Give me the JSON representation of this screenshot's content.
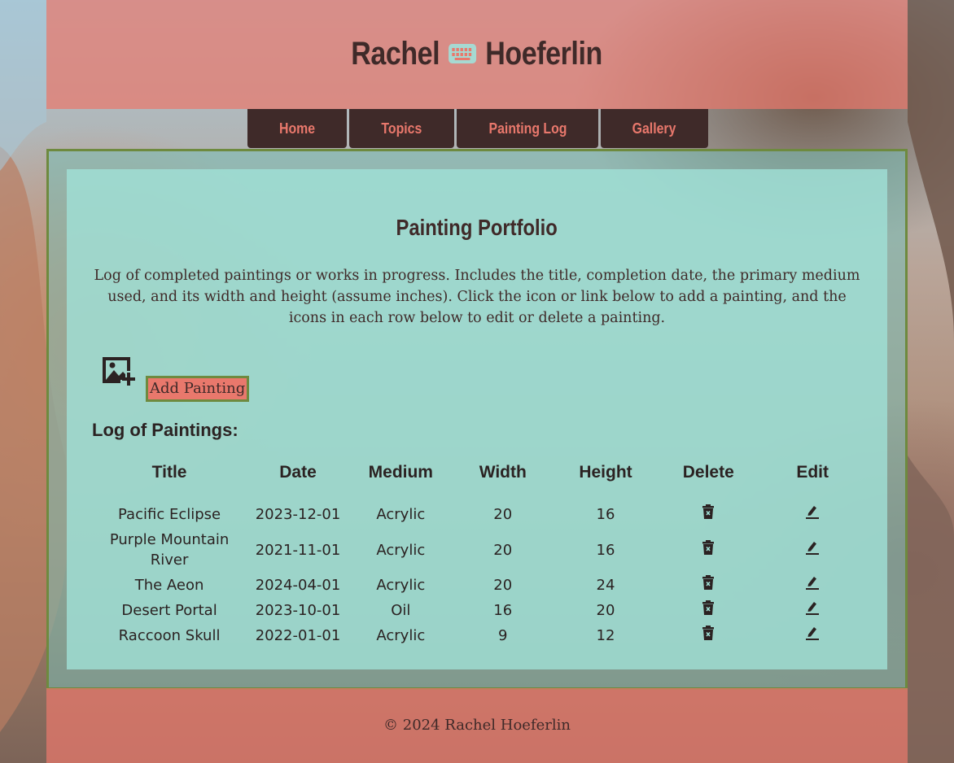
{
  "header": {
    "first_name": "Rachel",
    "last_name": "Hoeferlin",
    "logo_icon": "keyboard-icon"
  },
  "nav": {
    "home": "Home",
    "topics": "Topics",
    "painting_log": "Painting Log",
    "gallery": "Gallery"
  },
  "main": {
    "title": "Painting Portfolio",
    "intro": "Log of completed paintings or works in progress. Includes the title, completion date, the primary medium used, and its width and height (assume inches). Click the icon or link below to add a painting, and the icons in each row below to edit or delete a painting.",
    "add_icon": "add-image-icon",
    "add_link": "Add Painting",
    "log_heading": "Log of Paintings:"
  },
  "table": {
    "headers": {
      "title": "Title",
      "date": "Date",
      "medium": "Medium",
      "width": "Width",
      "height": "Height",
      "delete": "Delete",
      "edit": "Edit"
    },
    "rows": [
      {
        "title": "Pacific Eclipse",
        "date": "2023-12-01",
        "medium": "Acrylic",
        "width": "20",
        "height": "16"
      },
      {
        "title": "Purple Mountain River",
        "date": "2021-11-01",
        "medium": "Acrylic",
        "width": "20",
        "height": "16"
      },
      {
        "title": "The Aeon",
        "date": "2024-04-01",
        "medium": "Acrylic",
        "width": "20",
        "height": "24"
      },
      {
        "title": "Desert Portal",
        "date": "2023-10-01",
        "medium": "Oil",
        "width": "16",
        "height": "20"
      },
      {
        "title": "Raccoon Skull",
        "date": "2022-01-01",
        "medium": "Acrylic",
        "width": "9",
        "height": "12"
      }
    ]
  },
  "footer": {
    "text": "© 2024 Rachel Hoeferlin"
  },
  "colors": {
    "header_bg": "#e9786c",
    "nav_bg": "#3f2a29",
    "nav_text": "#e9786c",
    "border": "#6e8a3f",
    "content_bg": "#a0e1d7",
    "text": "#3f2a29"
  }
}
